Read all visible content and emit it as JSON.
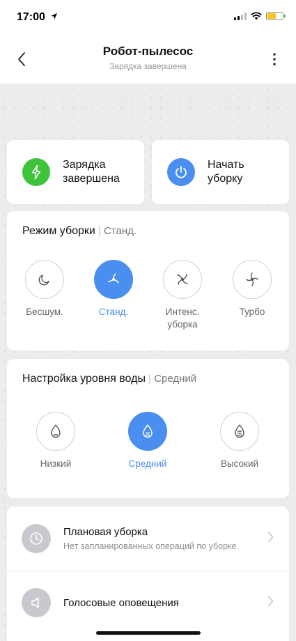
{
  "status_bar": {
    "time": "17:00"
  },
  "header": {
    "title": "Робот-пылесос",
    "subtitle": "Зарядка завершена"
  },
  "status_cards": {
    "charging": {
      "line1": "Зарядка",
      "line2": "завершена",
      "color": "#3ec33a",
      "icon": "lightning-icon"
    },
    "start": {
      "line1": "Начать",
      "line2": "уборку",
      "color": "#4a8ef0",
      "icon": "power-icon"
    }
  },
  "cleaning_mode": {
    "title": "Режим уборки",
    "value": "Стand.",
    "options": [
      {
        "label": "Бесшум.",
        "icon": "moon-icon",
        "active": false
      },
      {
        "label": "Станд.",
        "icon": "fan-icon",
        "active": true
      },
      {
        "label_line1": "Интенс.",
        "label_line2": "уборка",
        "icon": "fan-icon",
        "active": false
      },
      {
        "label": "Турбо",
        "icon": "fan-icon",
        "active": false
      }
    ]
  },
  "water_level": {
    "title": "Настройка уровня воды",
    "value": "Средний",
    "options": [
      {
        "label": "Низкий",
        "icon": "drop-low-icon",
        "active": false
      },
      {
        "label": "Средний",
        "icon": "drop-medium-icon",
        "active": true
      },
      {
        "label": "Высокий",
        "icon": "drop-high-icon",
        "active": false
      }
    ]
  },
  "settings": {
    "scheduled": {
      "title": "Плановая уборка",
      "subtitle": "Нет запланированных операций по уборке",
      "icon": "clock-icon"
    },
    "voice": {
      "title": "Голосовые оповещения",
      "icon": "speaker-icon"
    }
  },
  "colors": {
    "accent": "#4a8ef0",
    "success": "#3ec33a",
    "background": "#ececec"
  }
}
